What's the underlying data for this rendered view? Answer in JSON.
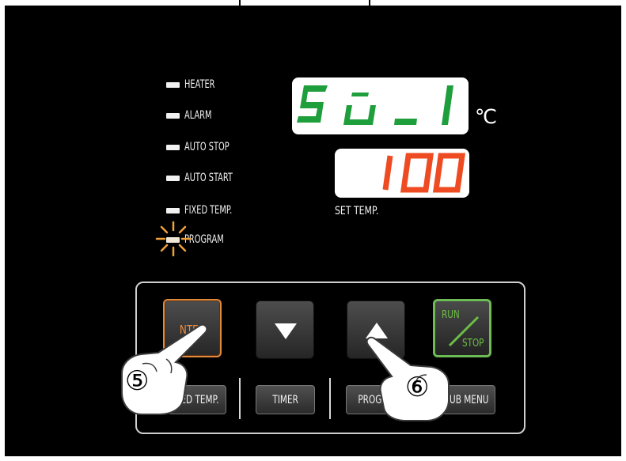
{
  "indicators": [
    {
      "label": "HEATER",
      "state": "off"
    },
    {
      "label": "ALARM",
      "state": "off"
    },
    {
      "label": "AUTO STOP",
      "state": "off"
    },
    {
      "label": "AUTO START",
      "state": "off"
    },
    {
      "label": "FIXED TEMP.",
      "state": "off"
    },
    {
      "label": "PROGRAM",
      "state": "blinking"
    }
  ],
  "displays": {
    "main": {
      "text": "SU_1",
      "color": "#1f9e3c"
    },
    "unit": "℃",
    "set": {
      "text": "100",
      "color": "#ee4b22"
    },
    "set_label": "SET TEMP."
  },
  "keys": {
    "enter": "NTER",
    "down_icon": "triangle-down-icon",
    "up_icon": "triangle-up-icon",
    "run": "RUN",
    "stop": "STOP",
    "fixed_temp": "XED TEMP.",
    "timer": "TIMER",
    "program": "PROGRA",
    "sub_menu": "SUB MENU"
  },
  "steps": {
    "step5": "⑤",
    "step6": "⑥"
  },
  "colors": {
    "enter_accent": "#e18a3a",
    "run_accent": "#6dbb55",
    "blink": "#f2a13a"
  }
}
